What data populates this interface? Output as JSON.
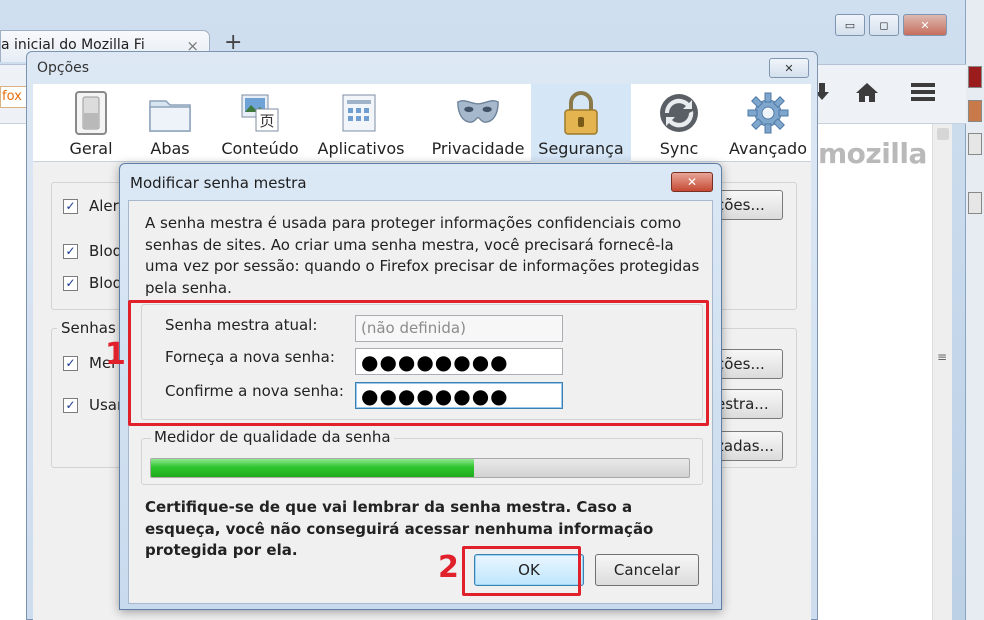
{
  "firefox": {
    "tab_title": "a inicial do Mozilla Fi",
    "tab_close": "×",
    "new_tab": "+",
    "address_fragment": "fox",
    "page_brand": "mozilla",
    "window_controls": {
      "minimize": "▭",
      "maximize": "◻",
      "close": "✕"
    },
    "icons": [
      "home-icon",
      "menu-icon",
      "download-icon"
    ]
  },
  "options": {
    "title": "Opções",
    "close": "✕",
    "tabs": [
      {
        "label": "Geral",
        "icon": "switch-icon"
      },
      {
        "label": "Abas",
        "icon": "folder-icon"
      },
      {
        "label": "Conteúdo",
        "icon": "content-icon"
      },
      {
        "label": "Aplicativos",
        "icon": "applications-icon"
      },
      {
        "label": "Privacidade",
        "icon": "mask-icon"
      },
      {
        "label": "Segurança",
        "icon": "padlock-icon"
      },
      {
        "label": "Sync",
        "icon": "sync-icon"
      },
      {
        "label": "Avançado",
        "icon": "gear-icon"
      }
    ],
    "selected_tab": "Segurança",
    "checkboxes_top": [
      "Aler",
      "Bloq",
      "Bloq"
    ],
    "section_passwords": "Senhas",
    "checkboxes_passwords": [
      "Mer",
      "Usar"
    ],
    "buttons": [
      "ções...",
      "ções...",
      "estra...",
      "zadas..."
    ]
  },
  "master_password": {
    "title": "Modificar senha mestra",
    "close": "✕",
    "description": "A senha mestra é usada para proteger informações confidenciais como senhas de sites. Ao criar uma senha mestra, você precisará fornecê-la uma vez por sessão: quando o Firefox precisar de informações protegidas pela senha.",
    "current_label": "Senha mestra atual:",
    "current_value": "(não definida)",
    "new_label": "Forneça a nova senha:",
    "new_value": "●●●●●●●●",
    "confirm_label": "Confirme a nova senha:",
    "confirm_value": "●●●●●●●●",
    "meter_label": "Medidor de qualidade da senha",
    "meter_level_percent": 60,
    "warning": "Certifique-se de que vai lembrar da senha mestra. Caso a esqueça, você não conseguirá acessar nenhuma informação protegida por ela.",
    "ok": "OK",
    "cancel": "Cancelar"
  },
  "annotations": {
    "step1": "1",
    "step2": "2",
    "color": "#e0202a"
  },
  "swatch_colors": [
    "#9b1c1c",
    "#c87a4a",
    "#e6e6e6",
    "#e6e6e6"
  ]
}
